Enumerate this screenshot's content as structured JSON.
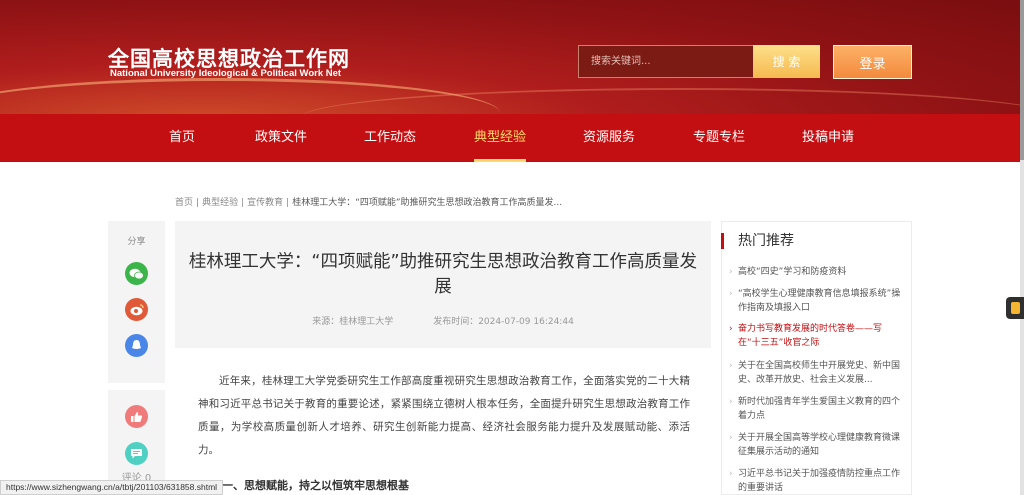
{
  "header": {
    "logo_cn": "全国高校思想政治工作网",
    "logo_en": "National University Ideological & Political Work Net",
    "search_placeholder": "搜索关键词...",
    "search_button": "搜 索",
    "login_button": "登录"
  },
  "nav": {
    "items": [
      {
        "label": "首页"
      },
      {
        "label": "政策文件"
      },
      {
        "label": "工作动态"
      },
      {
        "label": "典型经验",
        "active": true
      },
      {
        "label": "资源服务"
      },
      {
        "label": "专题专栏"
      },
      {
        "label": "投稿申请"
      }
    ]
  },
  "breadcrumb": {
    "items": [
      "首页",
      "典型经验",
      "宣传教育"
    ],
    "current": "桂林理工大学：“四项赋能”助推研究生思想政治教育工作高质量发..."
  },
  "share": {
    "title": "分享",
    "icons": [
      "wechat-icon",
      "weibo-icon",
      "qq-icon",
      "like-icon",
      "comment-icon"
    ],
    "comment_label": "评论 0"
  },
  "article": {
    "title": "桂林理工大学：“四项赋能”助推研究生思想政治教育工作高质量发展",
    "source": "来源：桂林理工大学",
    "published": "发布时间：2024-07-09 16:24:44",
    "paragraph": "近年来，桂林理工大学党委研究生工作部高度重视研究生思想政治教育工作，全面落实党的二十大精神和习近平总书记关于教育的重要论述，紧紧围绕立德树人根本任务，全面提升研究生思想政治教育工作质量，为学校高质量创新人才培养、研究生创新能力提高、经济社会服务能力提升及发展赋动能、添活力。",
    "section_heading": "一、思想赋能，持之以恒筑牢思想根基"
  },
  "hot": {
    "title": "热门推荐",
    "items": [
      {
        "text": "高校“四史”学习和防疫资料"
      },
      {
        "text": "“高校学生心理健康教育信息填报系统”操作指南及填报入口"
      },
      {
        "text": "奋力书写教育发展的时代答卷——写在“十三五”收官之际",
        "highlight": true
      },
      {
        "text": "关于在全国高校师生中开展党史、新中国史、改革开放史、社会主义发展..."
      },
      {
        "text": "新时代加强青年学生爱国主义教育的四个着力点"
      },
      {
        "text": "关于开展全国高等学校心理健康教育微课征集展示活动的通知"
      },
      {
        "text": "习近平总书记关于加强疫情防控重点工作的重要讲话"
      }
    ]
  },
  "status_url": "https://www.sizhengwang.cn/a/tbtj/201103/631858.shtml",
  "colors": {
    "brand_red": "#c40f12",
    "nav_active": "#ffd96b",
    "search_button": "#f6b94f",
    "login_button": "#f38a3d"
  }
}
